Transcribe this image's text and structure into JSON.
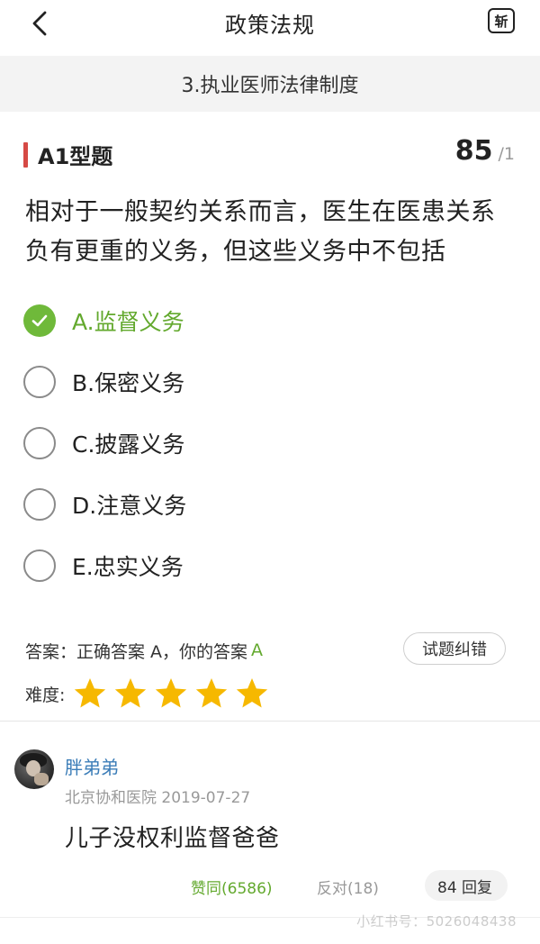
{
  "header": {
    "title": "政策法规",
    "simplified_toggle": "斩"
  },
  "chapter": {
    "label": "3.执业医师法律制度"
  },
  "question": {
    "type_label": "A1型题",
    "number_current": "85",
    "number_total": "/1",
    "text": "相对于一般契约关系而言，医生在医患关系负有更重的义务，但这些义务中不包括",
    "options": [
      {
        "label": "A.监督义务",
        "selected": true,
        "correct": true
      },
      {
        "label": "B.保密义务",
        "selected": false,
        "correct": false
      },
      {
        "label": "C.披露义务",
        "selected": false,
        "correct": false
      },
      {
        "label": "D.注意义务",
        "selected": false,
        "correct": false
      },
      {
        "label": "E.忠实义务",
        "selected": false,
        "correct": false
      }
    ]
  },
  "answer": {
    "text": "答案：正确答案 A，你的答案",
    "mine": "A",
    "report_button": "试题纠错"
  },
  "difficulty": {
    "label": "难度:",
    "stars": 5,
    "max": 5
  },
  "comment": {
    "username": "胖弟弟",
    "meta": "北京协和医院 2019-07-27",
    "text": "儿子没权利监督爸爸",
    "like": "赞同(6586)",
    "dislike": "反对(18)",
    "reply": "84 回复"
  },
  "watermark": "小红书号：5026048438",
  "colors": {
    "accent_green": "#6fb93a",
    "accent_red": "#d64a45",
    "link_blue": "#3b7db8",
    "star": "#f6b800"
  }
}
